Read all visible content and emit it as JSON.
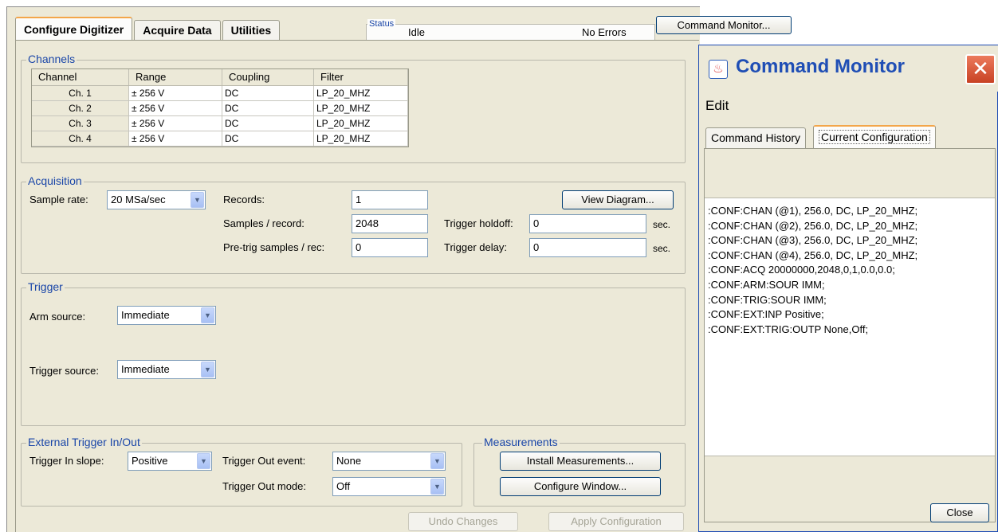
{
  "tabs": [
    "Configure Digitizer",
    "Acquire Data",
    "Utilities"
  ],
  "status": {
    "legend": "Status",
    "state": "Idle",
    "errors": "No Errors"
  },
  "command_monitor_button": "Command Monitor...",
  "channels": {
    "legend": "Channels",
    "columns": [
      "Channel",
      "Range",
      "Coupling",
      "Filter"
    ],
    "rows": [
      [
        "Ch. 1",
        "± 256 V",
        "DC",
        "LP_20_MHZ"
      ],
      [
        "Ch. 2",
        "± 256 V",
        "DC",
        "LP_20_MHZ"
      ],
      [
        "Ch. 3",
        "± 256 V",
        "DC",
        "LP_20_MHZ"
      ],
      [
        "Ch. 4",
        "± 256 V",
        "DC",
        "LP_20_MHZ"
      ]
    ]
  },
  "acquisition": {
    "legend": "Acquisition",
    "sample_rate_label": "Sample rate:",
    "sample_rate_value": "20 MSa/sec",
    "records_label": "Records:",
    "records_value": "1",
    "samples_label": "Samples / record:",
    "samples_value": "2048",
    "pretrig_label": "Pre-trig samples / rec:",
    "pretrig_value": "0",
    "view_diagram": "View Diagram...",
    "holdoff_label": "Trigger holdoff:",
    "holdoff_value": "0",
    "holdoff_unit": "sec.",
    "delay_label": "Trigger delay:",
    "delay_value": "0",
    "delay_unit": "sec."
  },
  "trigger": {
    "legend": "Trigger",
    "arm_label": "Arm source:",
    "arm_value": "Immediate",
    "source_label": "Trigger source:",
    "source_value": "Immediate"
  },
  "external": {
    "legend": "External Trigger In/Out",
    "slope_label": "Trigger In slope:",
    "slope_value": "Positive",
    "out_event_label": "Trigger Out event:",
    "out_event_value": "None",
    "out_mode_label": "Trigger Out mode:",
    "out_mode_value": "Off"
  },
  "measurements": {
    "legend": "Measurements",
    "install": "Install Measurements...",
    "configure": "Configure Window..."
  },
  "footer": {
    "undo": "Undo Changes",
    "apply": "Apply Configuration"
  },
  "monitor": {
    "title": "Command Monitor",
    "menu_edit": "Edit",
    "tab_history": "Command History",
    "tab_config": "Current Configuration",
    "lines": [
      ":CONF:CHAN (@1), 256.0, DC, LP_20_MHZ;",
      ":CONF:CHAN (@2), 256.0, DC, LP_20_MHZ;",
      ":CONF:CHAN (@3), 256.0, DC, LP_20_MHZ;",
      ":CONF:CHAN (@4), 256.0, DC, LP_20_MHZ;",
      ":CONF:ACQ 20000000,2048,0,1,0.0,0.0;",
      ":CONF:ARM:SOUR IMM;",
      ":CONF:TRIG:SOUR IMM;",
      ":CONF:EXT:INP Positive;",
      ":CONF:EXT:TRIG:OUTP None,Off;"
    ],
    "close": "Close"
  }
}
